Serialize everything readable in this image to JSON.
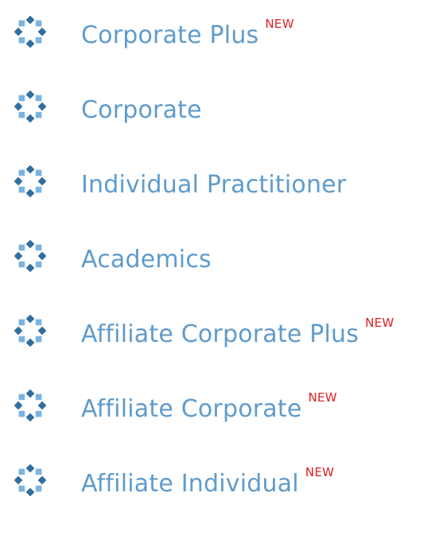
{
  "colors": {
    "link": "#5f9bcc",
    "badge": "#e02020",
    "icon_dark": "#2f6e9e",
    "icon_light": "#79b3e2"
  },
  "icon": "membership-star-icon",
  "items": [
    {
      "label": "Corporate Plus",
      "badge": "NEW"
    },
    {
      "label": "Corporate",
      "badge": ""
    },
    {
      "label": "Individual Practitioner",
      "badge": ""
    },
    {
      "label": "Academics",
      "badge": ""
    },
    {
      "label": "Affiliate Corporate Plus",
      "badge": "NEW"
    },
    {
      "label": "Affiliate Corporate",
      "badge": "NEW"
    },
    {
      "label": "Affiliate Individual",
      "badge": "NEW"
    }
  ]
}
